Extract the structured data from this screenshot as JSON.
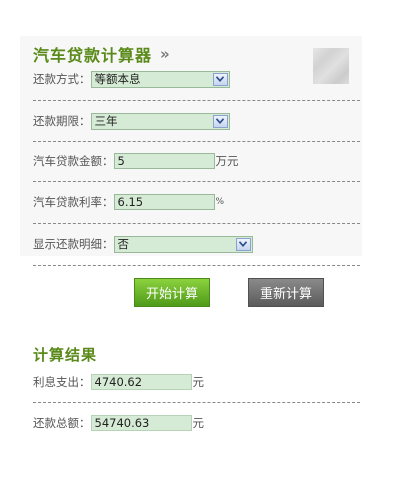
{
  "calculator": {
    "title": "汽车贷款计算器",
    "title_arrow": "»",
    "repayment_method": {
      "label": "还款方式：",
      "selected": "等额本息"
    },
    "term": {
      "label": "还款期限：",
      "selected": "三年"
    },
    "amount": {
      "label": "汽车贷款金额：",
      "value": "5",
      "unit": "万元"
    },
    "rate": {
      "label": "汽车贷款利率：",
      "value": "6.15",
      "unit": "%"
    },
    "show_details": {
      "label": "显示还款明细：",
      "selected": "否"
    },
    "start_button": "开始计算",
    "reset_button": "重新计算"
  },
  "result": {
    "title": "计算结果",
    "interest": {
      "label": "利息支出：",
      "value": "4740.62",
      "unit": "元"
    },
    "total": {
      "label": "还款总额：",
      "value": "54740.63",
      "unit": "元"
    }
  },
  "icons": {
    "title_arrow": "double-chevron-right-icon",
    "dropdown": "dropdown-arrow-icon",
    "avatar": "avatar-placeholder"
  },
  "colors": {
    "title": "#5a8a1a",
    "input_bg": "#d6ebd6",
    "start_button": "#6cb52a",
    "reset_button": "#707070"
  }
}
